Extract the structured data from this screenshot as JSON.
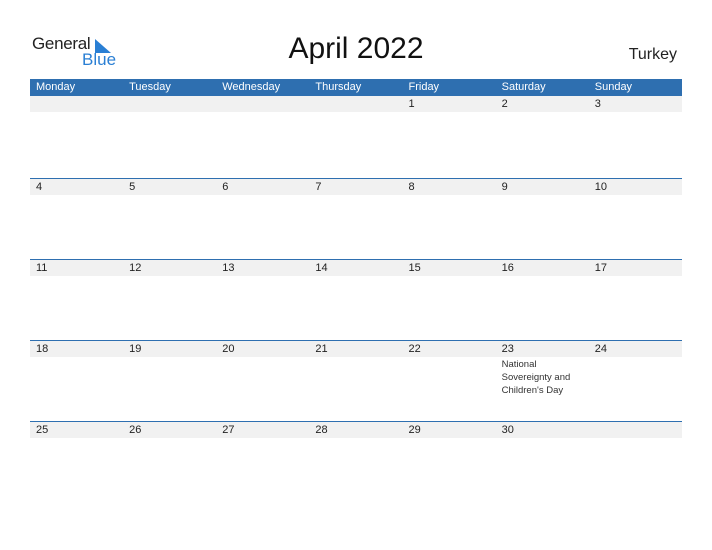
{
  "logo": {
    "word1": "General",
    "word2": "Blue"
  },
  "title": "April 2022",
  "country": "Turkey",
  "colors": {
    "accent": "#2e6fb0",
    "logo_blue": "#2a7fd4",
    "band": "#f1f1f1"
  },
  "weekdays": [
    "Monday",
    "Tuesday",
    "Wednesday",
    "Thursday",
    "Friday",
    "Saturday",
    "Sunday"
  ],
  "weeks": [
    [
      {
        "day": ""
      },
      {
        "day": ""
      },
      {
        "day": ""
      },
      {
        "day": ""
      },
      {
        "day": "1"
      },
      {
        "day": "2"
      },
      {
        "day": "3"
      }
    ],
    [
      {
        "day": "4"
      },
      {
        "day": "5"
      },
      {
        "day": "6"
      },
      {
        "day": "7"
      },
      {
        "day": "8"
      },
      {
        "day": "9"
      },
      {
        "day": "10"
      }
    ],
    [
      {
        "day": "11"
      },
      {
        "day": "12"
      },
      {
        "day": "13"
      },
      {
        "day": "14"
      },
      {
        "day": "15"
      },
      {
        "day": "16"
      },
      {
        "day": "17"
      }
    ],
    [
      {
        "day": "18"
      },
      {
        "day": "19"
      },
      {
        "day": "20"
      },
      {
        "day": "21"
      },
      {
        "day": "22"
      },
      {
        "day": "23",
        "event": "National Sovereignty and Children's Day"
      },
      {
        "day": "24"
      }
    ],
    [
      {
        "day": "25"
      },
      {
        "day": "26"
      },
      {
        "day": "27"
      },
      {
        "day": "28"
      },
      {
        "day": "29"
      },
      {
        "day": "30"
      },
      {
        "day": ""
      }
    ]
  ]
}
